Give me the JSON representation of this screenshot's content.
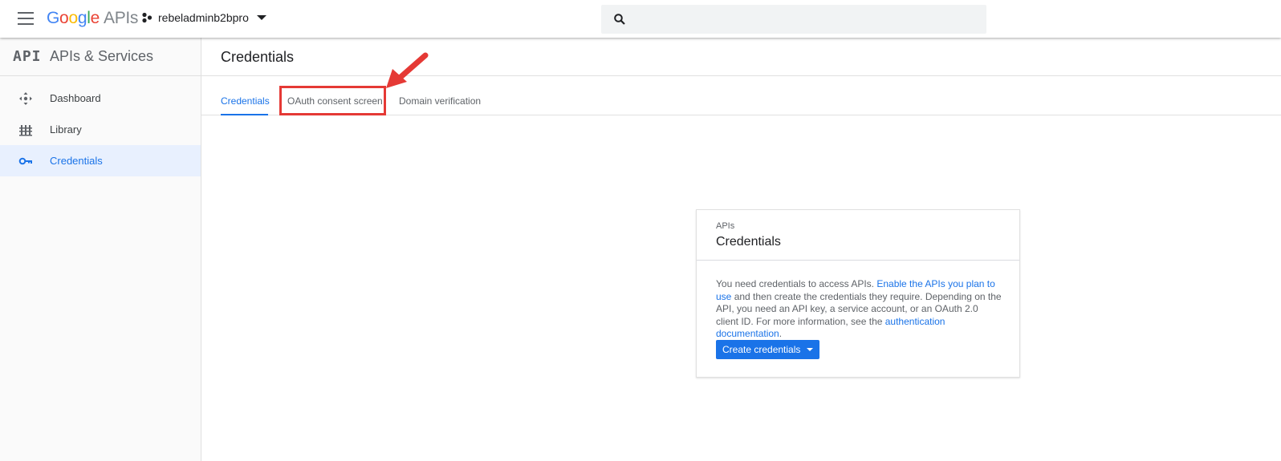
{
  "topbar": {
    "brand_letters": [
      "G",
      "o",
      "o",
      "g",
      "l",
      "e"
    ],
    "brand_suffix": "APIs",
    "project_name": "rebeladminb2bpro",
    "search_placeholder": ""
  },
  "sidebar": {
    "logo": "API",
    "title": "APIs & Services",
    "items": [
      {
        "label": "Dashboard",
        "icon": "dashboard-icon",
        "active": false
      },
      {
        "label": "Library",
        "icon": "library-icon",
        "active": false
      },
      {
        "label": "Credentials",
        "icon": "key-icon",
        "active": true
      }
    ]
  },
  "main": {
    "title": "Credentials",
    "tabs": [
      {
        "label": "Credentials",
        "active": true
      },
      {
        "label": "OAuth consent screen",
        "active": false,
        "highlighted": true
      },
      {
        "label": "Domain verification",
        "active": false
      }
    ]
  },
  "card": {
    "kicker": "APIs",
    "title": "Credentials",
    "text_1": "You need credentials to access APIs. ",
    "link_1": "Enable the APIs you plan to use",
    "text_2": " and then create the credentials they require. Depending on the API, you need an API key, a service account, or an OAuth 2.0 client ID. For more information, see the ",
    "link_2": "authentication documentation",
    "text_3": ".",
    "button_label": "Create credentials"
  },
  "colors": {
    "accent": "#1a73e8",
    "highlight": "#e53935",
    "nav_active_bg": "#e8f0fe"
  }
}
